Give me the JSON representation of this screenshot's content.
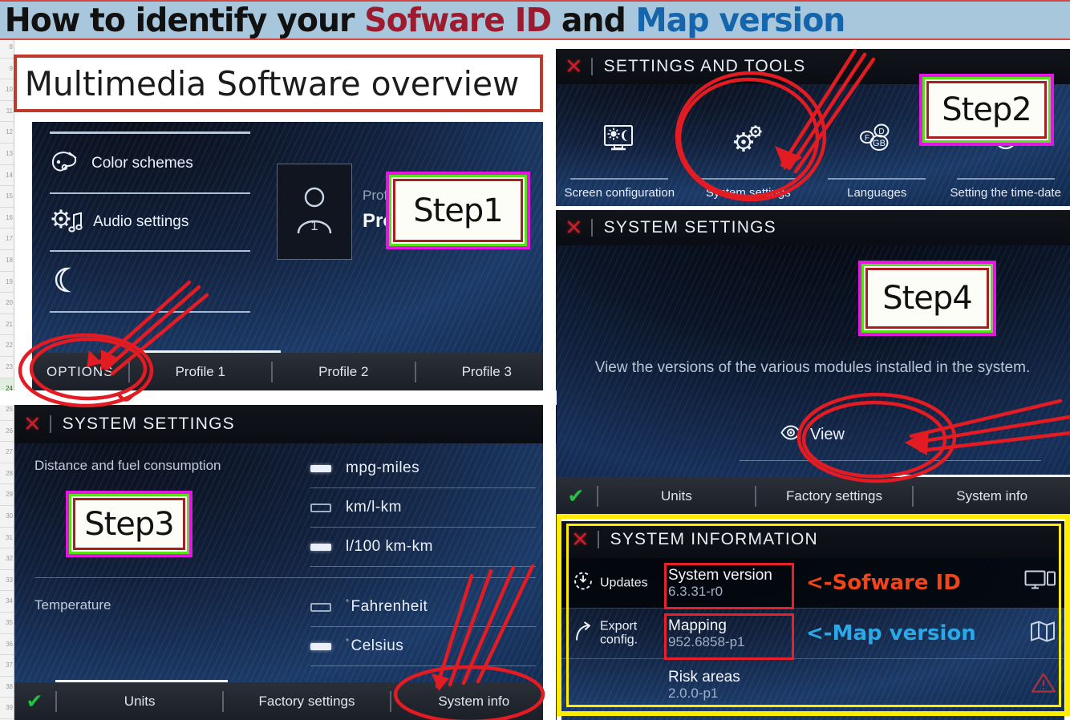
{
  "title": {
    "part1": "How to identify your ",
    "part2": "Sofware ID",
    "part3": " and ",
    "part4": "Map version",
    "colors": {
      "black": "#111111",
      "red": "#9c1b2e",
      "blue": "#1565ad",
      "band_bg": "#a9c7dc",
      "band_border": "#d24a43"
    }
  },
  "overview_label": "Multimedia Software overview",
  "steps": {
    "step1": "Step1",
    "step2": "Step2",
    "step3": "Step3",
    "step4": "Step4"
  },
  "panel_profile": {
    "menu": [
      {
        "label": "Color schemes",
        "icon": "palette-icon"
      },
      {
        "label": "Audio settings",
        "icon": "gear-music-icon"
      },
      {
        "label": "",
        "icon": "moon-icon"
      }
    ],
    "profile_avatar_number": "1",
    "profile_caption_small": "Profile ac",
    "profile_caption_big": "Profile",
    "tabs": {
      "options": "OPTIONS",
      "items": [
        "Profile 1",
        "Profile 2",
        "Profile 3"
      ]
    }
  },
  "panel_settings_tools": {
    "header": "SETTINGS AND TOOLS",
    "close_icon": "close-icon",
    "items": [
      {
        "label": "Screen configuration",
        "icon": "screen-brightness-icon"
      },
      {
        "label": "System settings",
        "icon": "gears-icon"
      },
      {
        "label": "Languages",
        "icon": "languages-icon"
      },
      {
        "label": "Setting the time-date",
        "icon": "clock-icon"
      }
    ]
  },
  "panel_system_settings_units": {
    "header": "SYSTEM SETTINGS",
    "close_icon": "close-icon",
    "group1_label": "Distance and fuel consumption",
    "group2_label": "Temperature",
    "options": [
      {
        "label": "mpg-miles",
        "selected": true
      },
      {
        "label": "km/l-km",
        "selected": false
      },
      {
        "label": "l/100 km-km",
        "selected": true
      },
      {
        "label": "Fahrenheit",
        "selected": false,
        "degree": true
      },
      {
        "label": "Celsius",
        "selected": true,
        "degree": true
      }
    ],
    "tabs": [
      "Units",
      "Factory settings",
      "System info"
    ],
    "confirm_icon": "check-icon"
  },
  "panel_system_settings_info": {
    "header": "SYSTEM SETTINGS",
    "close_icon": "close-icon",
    "description": "View the versions of the various modules installed in the system.",
    "view_label": "View",
    "view_icon": "eye-icon",
    "tabs": [
      "Units",
      "Factory settings",
      "System info"
    ],
    "confirm_icon": "check-icon"
  },
  "panel_system_information": {
    "header": "SYSTEM INFORMATION",
    "close_icon": "close-icon",
    "side_actions": [
      {
        "label": "Updates",
        "icon": "update-icon"
      },
      {
        "label": "Export config.",
        "icon": "export-icon"
      }
    ],
    "rows": [
      {
        "name": "System version",
        "value": "6.3.31-r0",
        "note": "<-Sofware ID",
        "note_color": "#f0441a",
        "right_icon": "monitor-icon"
      },
      {
        "name": "Mapping",
        "value": "952.6858-p1",
        "note": "<-Map version",
        "note_color": "#2aa8e8",
        "right_icon": "map-icon"
      },
      {
        "name": "Risk areas",
        "value": "2.0.0-p1",
        "note": "",
        "note_color": "",
        "right_icon": "warning-icon"
      }
    ]
  }
}
